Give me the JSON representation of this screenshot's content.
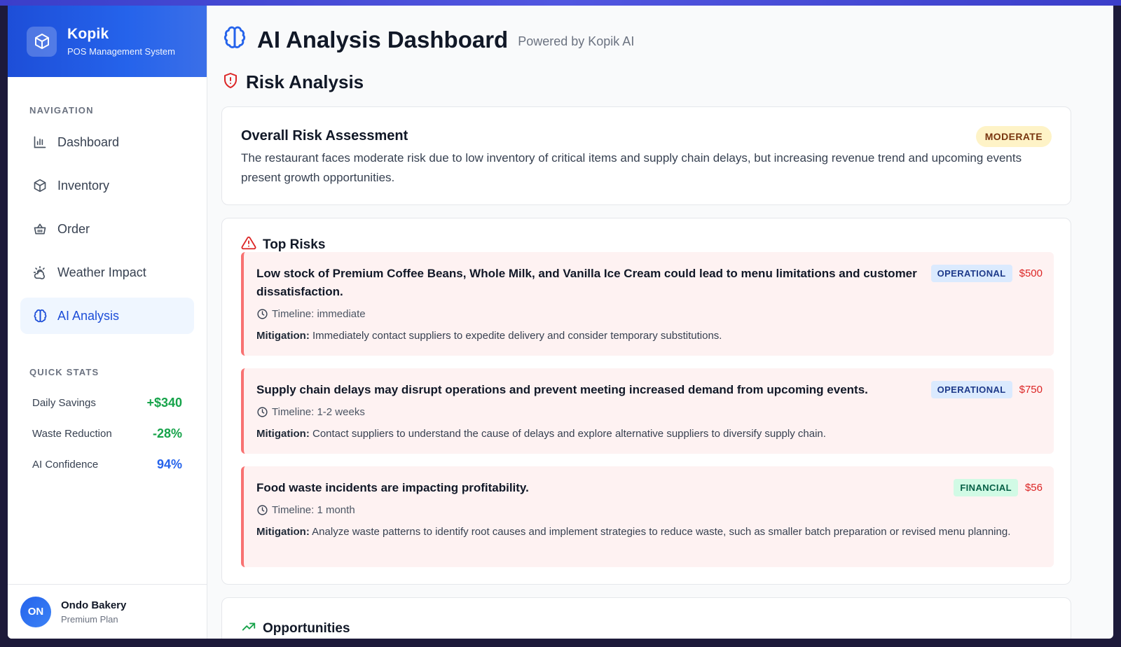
{
  "brand": {
    "name": "Kopik",
    "subtitle": "POS Management System"
  },
  "sidebar": {
    "nav_label": "NAVIGATION",
    "items": [
      {
        "label": "Dashboard",
        "icon": "bar-chart-icon",
        "active": false
      },
      {
        "label": "Inventory",
        "icon": "box-icon",
        "active": false
      },
      {
        "label": "Order",
        "icon": "basket-icon",
        "active": false
      },
      {
        "label": "Weather Impact",
        "icon": "sun-cloud-icon",
        "active": false
      },
      {
        "label": "AI Analysis",
        "icon": "brain-icon",
        "active": true
      }
    ],
    "stats_label": "QUICK STATS",
    "stats": [
      {
        "label": "Daily Savings",
        "value": "+$340",
        "color": "#16a34a"
      },
      {
        "label": "Waste Reduction",
        "value": "-28%",
        "color": "#16a34a"
      },
      {
        "label": "AI Confidence",
        "value": "94%",
        "color": "#2563eb"
      }
    ]
  },
  "user": {
    "initials": "ON",
    "name": "Ondo Bakery",
    "plan": "Premium Plan"
  },
  "page": {
    "title": "AI Analysis Dashboard",
    "subtitle": "Powered by Kopik AI"
  },
  "risk_section": {
    "title": "Risk Analysis",
    "overall": {
      "title": "Overall Risk Assessment",
      "level": "MODERATE",
      "description": "The restaurant faces moderate risk due to low inventory of critical items and supply chain delays, but increasing revenue trend and upcoming events present growth opportunities."
    },
    "top_risks_title": "Top Risks",
    "mitigation_label": "Mitigation:",
    "risks": [
      {
        "text": "Low stock of Premium Coffee Beans, Whole Milk, and Vanilla Ice Cream could lead to menu limitations and customer dissatisfaction.",
        "category": "OPERATIONAL",
        "amount": "$500",
        "timeline": "Timeline: immediate",
        "mitigation": "Immediately contact suppliers to expedite delivery and consider temporary substitutions."
      },
      {
        "text": "Supply chain delays may disrupt operations and prevent meeting increased demand from upcoming events.",
        "category": "OPERATIONAL",
        "amount": "$750",
        "timeline": "Timeline: 1-2 weeks",
        "mitigation": "Contact suppliers to understand the cause of delays and explore alternative suppliers to diversify supply chain."
      },
      {
        "text": "Food waste incidents are impacting profitability.",
        "category": "FINANCIAL",
        "amount": "$56",
        "timeline": "Timeline: 1 month",
        "mitigation": "Analyze waste patterns to identify root causes and implement strategies to reduce waste, such as smaller batch preparation or revised menu planning."
      }
    ]
  },
  "opportunities": {
    "title": "Opportunities"
  }
}
